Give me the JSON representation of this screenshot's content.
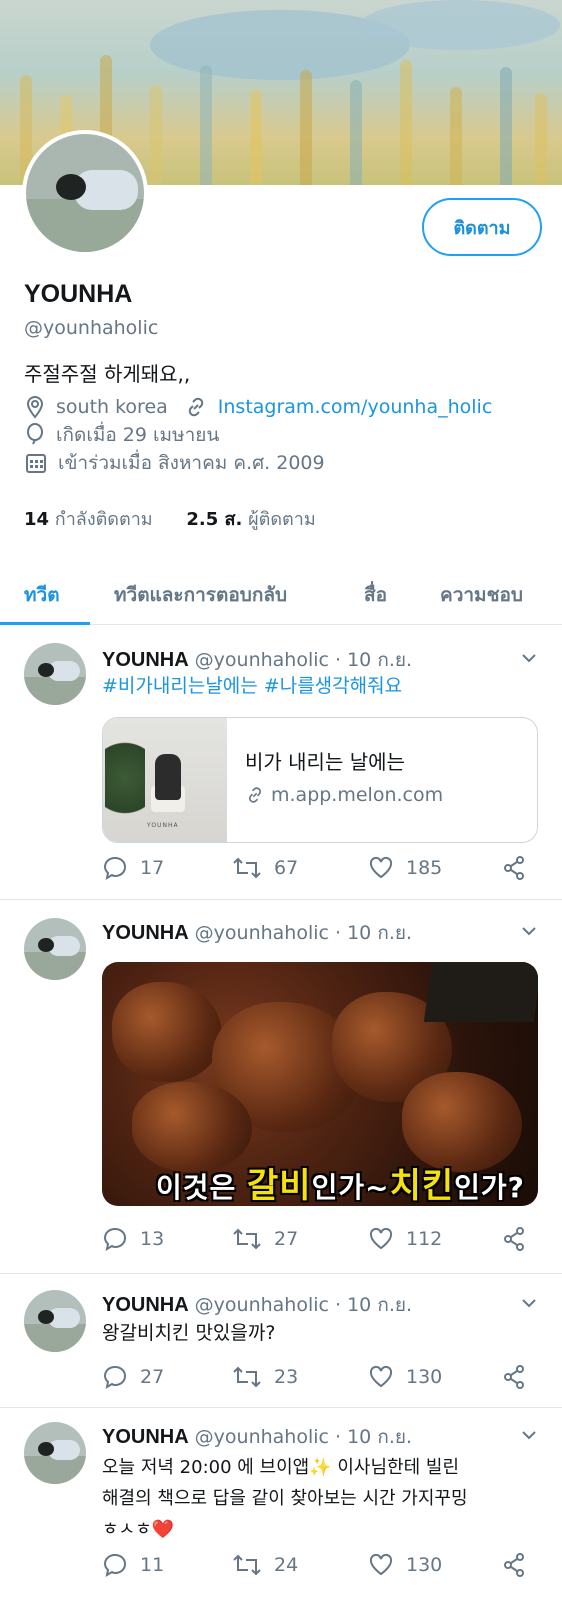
{
  "profile": {
    "follow_label": "ติดตาม",
    "display_name": "YOUNHA",
    "handle": "@younhaholic",
    "bio": "주절주절 하게돼요,,",
    "location": "south korea",
    "website": "Instagram.com/younha_holic",
    "birthday": "เกิดเมื่อ 29 เมษายน",
    "joined": "เข้าร่วมเมื่อ สิงหาคม ค.ศ. 2009",
    "following_count": "14",
    "following_label": "กำลังติดตาม",
    "followers_count": "2.5 ส.",
    "followers_label": "ผู้ติดตาม"
  },
  "tabs": [
    {
      "label": "ทวีต",
      "active": true
    },
    {
      "label": "ทวีตและการตอบกลับ",
      "active": false
    },
    {
      "label": "สื่อ",
      "active": false
    },
    {
      "label": "ความชอบ",
      "active": false
    }
  ],
  "tweets": [
    {
      "name": "YOUNHA",
      "meta": "@younhaholic · 10 ก.ย.",
      "hashtags": "#비가내리는날에는 #나를생각해줘요",
      "card_title": "비가 내리는 날에는",
      "card_url": "m.app.melon.com",
      "card_mark": "YOUNHA",
      "replies": "17",
      "retweets": "67",
      "likes": "185"
    },
    {
      "name": "YOUNHA",
      "meta": "@younhaholic · 10 ก.ย.",
      "caption_a": "이것은 ",
      "caption_b": "갈비",
      "caption_c": "인가~",
      "caption_d": "치킨",
      "caption_e": "인가?",
      "replies": "13",
      "retweets": "27",
      "likes": "112"
    },
    {
      "name": "YOUNHA",
      "meta": "@younhaholic · 10 ก.ย.",
      "text": "왕갈비치킨 맛있을까?",
      "replies": "27",
      "retweets": "23",
      "likes": "130"
    },
    {
      "name": "YOUNHA",
      "meta": "@younhaholic · 10 ก.ย.",
      "text_line1": "오늘 저녁 20:00 에 브이앱✨ 이사님한테 빌린",
      "text_line2": "해결의 책으로 답을 같이 찾아보는 시간 가지꾸밍",
      "text_line3": "ㅎㅅㅎ❤️",
      "replies": "11",
      "retweets": "24",
      "likes": "130"
    }
  ],
  "colors": {
    "accent": "#1da1f2",
    "link": "#1b95e0",
    "muted": "#657786"
  }
}
